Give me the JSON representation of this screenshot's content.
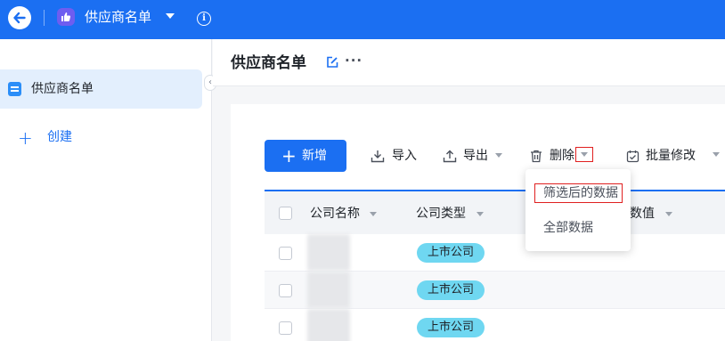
{
  "topbar": {
    "app_title": "供应商名单",
    "info_glyph": "i"
  },
  "sidebar": {
    "items": [
      {
        "label": "供应商名单",
        "icon": "doc-icon"
      }
    ],
    "create_label": "创建",
    "collapse_glyph": "‹"
  },
  "page": {
    "title": "供应商名单",
    "more_glyph": "···"
  },
  "toolbar": {
    "new_label": "新增",
    "import_label": "导入",
    "export_label": "导出",
    "delete_label": "删除",
    "batch_edit_label": "批量修改"
  },
  "delete_menu": {
    "items": [
      "筛选后的数据",
      "全部数据"
    ]
  },
  "table": {
    "columns": [
      "公司名称",
      "公司类型",
      "数值"
    ],
    "rows": [
      {
        "company_name": "",
        "company_type": "上市公司"
      },
      {
        "company_name": "",
        "company_type": "上市公司"
      },
      {
        "company_name": "",
        "company_type": "上市公司"
      }
    ]
  },
  "colors": {
    "primary": "#1b6ff2",
    "tag": "#6fd7f1",
    "highlight_box": "#e02020",
    "app_icon": "#6e5df0"
  }
}
